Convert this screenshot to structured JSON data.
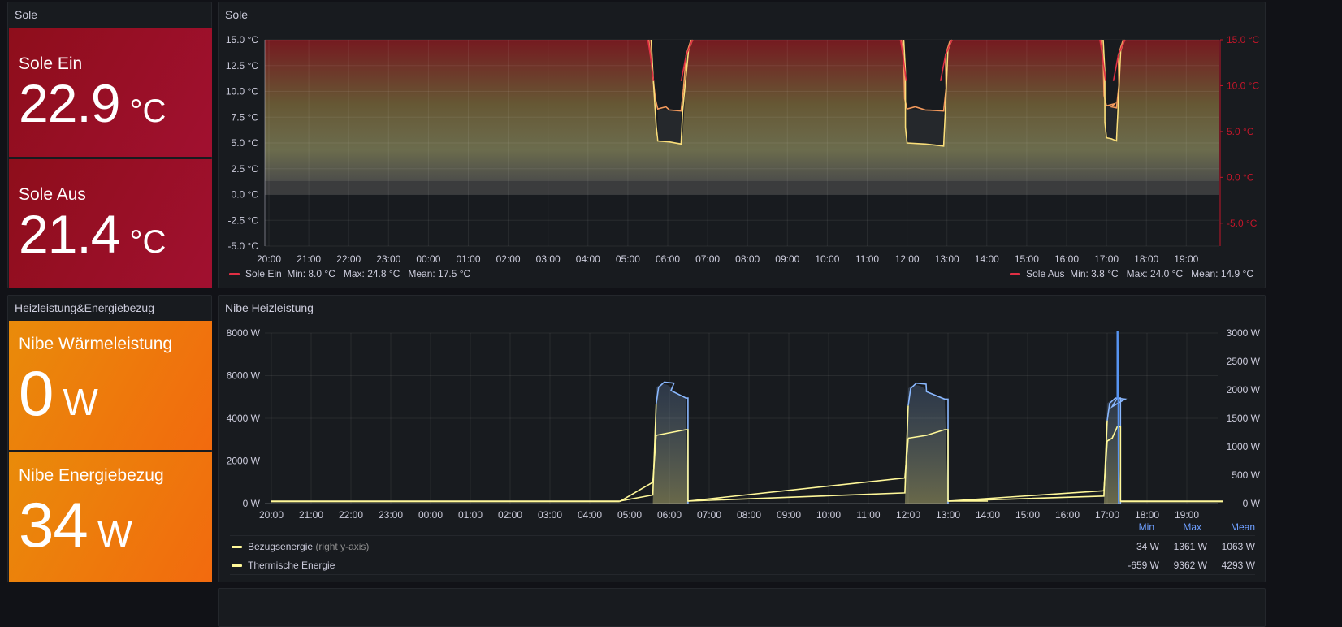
{
  "colors": {
    "background": "#111217",
    "panel": "#181b1f",
    "red_stat": "#a11030",
    "orange_stat": "#f26a0e",
    "sole_ein": "#f2495c",
    "sole_aus": "#fade2a",
    "bezugsenergie": "#8ab8ff",
    "thermische": "#fff899",
    "legend_header": "#6e9fff"
  },
  "sole_stats": {
    "title": "Sole",
    "ein": {
      "label": "Sole Ein",
      "value": "22.9",
      "unit": "°C"
    },
    "aus": {
      "label": "Sole Aus",
      "value": "21.4",
      "unit": "°C"
    }
  },
  "heiz_stats": {
    "title": "Heizleistung&Energiebezug",
    "waerme": {
      "label": "Nibe Wärmeleistung",
      "value": "0",
      "unit": "W"
    },
    "bezug": {
      "label": "Nibe Energiebezug",
      "value": "34",
      "unit": "W"
    }
  },
  "sole_chart": {
    "title": "Sole",
    "y_left_ticks": [
      "15.0 °C",
      "12.5 °C",
      "10.0 °C",
      "7.5 °C",
      "5.0 °C",
      "2.5 °C",
      "0.0 °C",
      "-2.5 °C",
      "-5.0 °C"
    ],
    "y_right_ticks": [
      "15.0 °C",
      "10.0 °C",
      "5.0 °C",
      "0.0 °C",
      "-5.0 °C"
    ],
    "x_ticks": [
      "20:00",
      "21:00",
      "22:00",
      "23:00",
      "00:00",
      "01:00",
      "02:00",
      "03:00",
      "04:00",
      "05:00",
      "06:00",
      "07:00",
      "08:00",
      "09:00",
      "10:00",
      "11:00",
      "12:00",
      "13:00",
      "14:00",
      "15:00",
      "16:00",
      "17:00",
      "18:00",
      "19:00"
    ],
    "legend_left": {
      "name": "Sole Ein",
      "stats": "Min: 8.0 °C   Max: 24.8 °C   Mean: 17.5 °C"
    },
    "legend_right": {
      "name": "Sole Aus",
      "stats": "Min: 3.8 °C   Max: 24.0 °C   Mean: 14.9 °C"
    }
  },
  "heiz_chart": {
    "title": "Nibe Heizleistung",
    "y_left_ticks": [
      "8000 W",
      "6000 W",
      "4000 W",
      "2000 W",
      "0 W"
    ],
    "y_right_ticks": [
      "3000 W",
      "2500 W",
      "2000 W",
      "1500 W",
      "1000 W",
      "500 W",
      "0 W"
    ],
    "x_ticks": [
      "20:00",
      "21:00",
      "22:00",
      "23:00",
      "00:00",
      "01:00",
      "02:00",
      "03:00",
      "04:00",
      "05:00",
      "06:00",
      "07:00",
      "08:00",
      "09:00",
      "10:00",
      "11:00",
      "12:00",
      "13:00",
      "14:00",
      "15:00",
      "16:00",
      "17:00",
      "18:00",
      "19:00"
    ],
    "legend_headers": {
      "min": "Min",
      "max": "Max",
      "mean": "Mean"
    },
    "legend_rows": [
      {
        "name": "Bezugsenergie",
        "note": "(right y-axis)",
        "min": "34 W",
        "max": "1361 W",
        "mean": "1063 W"
      },
      {
        "name": "Thermische Energie",
        "note": "",
        "min": "-659 W",
        "max": "9362 W",
        "mean": "4293 W"
      }
    ]
  },
  "chart_data": [
    {
      "type": "line",
      "title": "Sole",
      "ylim_left": [
        -5,
        15
      ],
      "ylim_right": [
        -7.5,
        15
      ],
      "x": [
        "20:00",
        "05:35",
        "05:45",
        "06:00",
        "06:20",
        "06:28",
        "06:35",
        "11:55",
        "12:00",
        "12:15",
        "12:45",
        "12:58",
        "13:05",
        "16:55",
        "17:05",
        "17:20",
        "17:25"
      ],
      "series": [
        {
          "name": "Sole Ein",
          "values": [
            15,
            15,
            8.5,
            8.2,
            8.0,
            8.2,
            15,
            15,
            8.7,
            8.3,
            8.1,
            8.3,
            15,
            15,
            8.6,
            8.6,
            15
          ]
        },
        {
          "name": "Sole Aus",
          "values": [
            15,
            15,
            5.5,
            5.2,
            4.9,
            5.0,
            15,
            15,
            5.7,
            5.2,
            4.8,
            5.0,
            15,
            15,
            5.5,
            5.5,
            15
          ]
        }
      ]
    },
    {
      "type": "line",
      "title": "Nibe Heizleistung",
      "ylim_left": [
        0,
        8000
      ],
      "ylim_right": [
        0,
        3000
      ],
      "x": [
        "20:00",
        "04:45",
        "05:35",
        "05:40",
        "06:00",
        "06:25",
        "06:28",
        "12:00",
        "12:05",
        "12:30",
        "12:55",
        "13:00",
        "17:00",
        "17:05",
        "17:15",
        "17:20"
      ],
      "series": [
        {
          "name": "Bezugsenergie",
          "values": [
            34,
            34,
            400,
            1050,
            1200,
            1300,
            30,
            600,
            1150,
            1250,
            1300,
            34,
            600,
            1100,
            3000,
            34
          ]
        },
        {
          "name": "Thermische Energie",
          "values": [
            0,
            0,
            1000,
            5200,
            5400,
            4950,
            0,
            1200,
            5300,
            5400,
            4900,
            0,
            500,
            4600,
            4950,
            0
          ]
        }
      ]
    }
  ]
}
